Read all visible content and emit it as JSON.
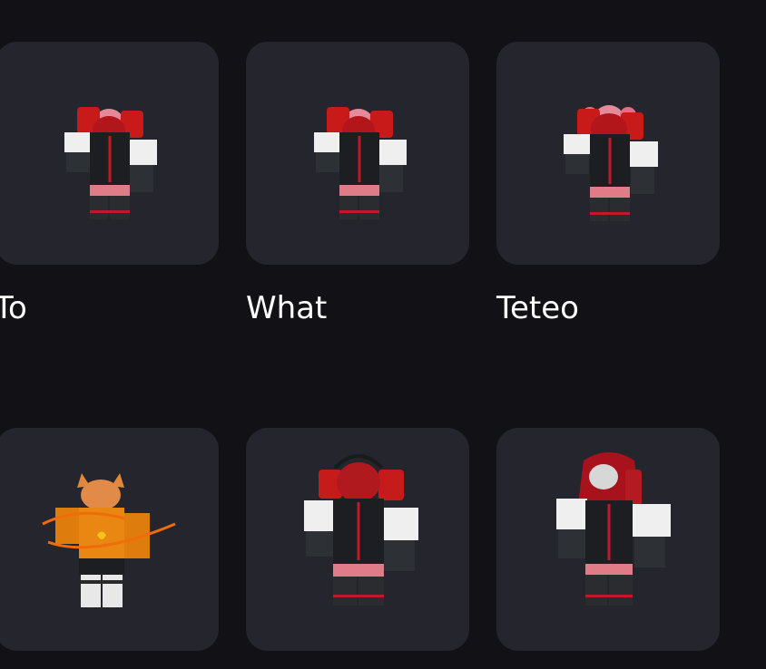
{
  "outfits": [
    {
      "name": "To",
      "thumbnail_icon": "avatar-thumbnail-icon",
      "style": "red-black-with-pink-chibi"
    },
    {
      "name": "What",
      "thumbnail_icon": "avatar-thumbnail-icon",
      "style": "red-black-with-pink-chibi"
    },
    {
      "name": "Teteo",
      "thumbnail_icon": "avatar-thumbnail-icon",
      "style": "red-black-with-pink-chibi"
    },
    {
      "name": "",
      "thumbnail_icon": "avatar-thumbnail-icon",
      "style": "orange-cat-hoodie"
    },
    {
      "name": "",
      "thumbnail_icon": "avatar-thumbnail-icon",
      "style": "red-pigtails-black"
    },
    {
      "name": "",
      "thumbnail_icon": "avatar-thumbnail-icon",
      "style": "red-hair-black"
    }
  ],
  "colors": {
    "background": "#111116",
    "tile": "#25262d",
    "text": "#ffffff"
  }
}
